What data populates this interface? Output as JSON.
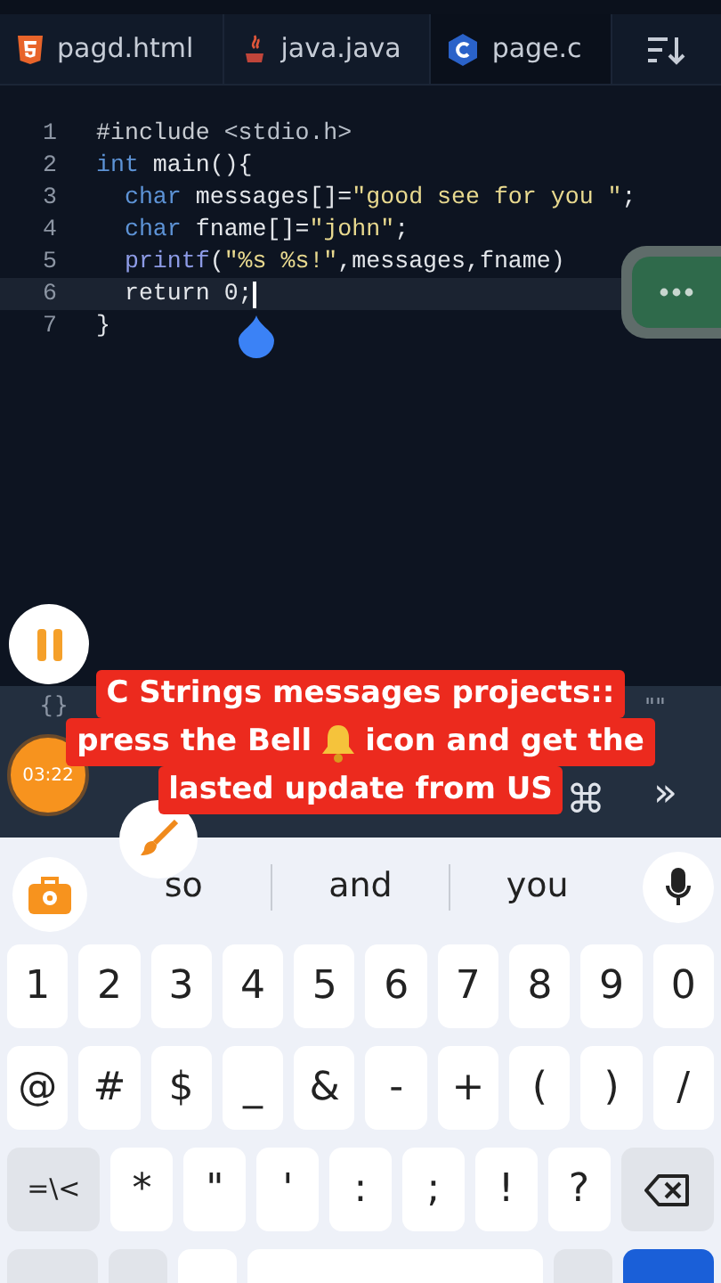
{
  "tabs": [
    {
      "label": "pagd.html",
      "kind": "html",
      "selected": false
    },
    {
      "label": "java.java",
      "kind": "java",
      "selected": false
    },
    {
      "label": "page.c",
      "kind": "c",
      "selected": true
    }
  ],
  "code": {
    "lines": [
      {
        "number": "1",
        "current": false,
        "tokens": [
          {
            "text": "#include ",
            "kind": "directive"
          },
          {
            "text": "<stdio.h>",
            "kind": "header"
          }
        ]
      },
      {
        "number": "2",
        "current": false,
        "tokens": [
          {
            "text": "int",
            "kind": "keyword"
          },
          {
            "text": " main(){",
            "kind": "plain"
          }
        ]
      },
      {
        "number": "3",
        "current": false,
        "tokens": [
          {
            "text": "  char",
            "kind": "keyword"
          },
          {
            "text": " messages[]=",
            "kind": "plain"
          },
          {
            "text": "\"good see for you \"",
            "kind": "string"
          },
          {
            "text": ";",
            "kind": "plain"
          }
        ]
      },
      {
        "number": "4",
        "current": false,
        "tokens": [
          {
            "text": "  char",
            "kind": "keyword"
          },
          {
            "text": " fname[]=",
            "kind": "plain"
          },
          {
            "text": "\"john\"",
            "kind": "string"
          },
          {
            "text": ";",
            "kind": "plain"
          }
        ]
      },
      {
        "number": "5",
        "current": false,
        "tokens": [
          {
            "text": "  printf",
            "kind": "function"
          },
          {
            "text": "(",
            "kind": "plain"
          },
          {
            "text": "\"%s %s!\"",
            "kind": "string"
          },
          {
            "text": ",messages,fname)",
            "kind": "plain"
          }
        ]
      },
      {
        "number": "6",
        "current": true,
        "tokens": [
          {
            "text": "  return 0;",
            "kind": "plain"
          }
        ]
      },
      {
        "number": "7",
        "current": false,
        "tokens": [
          {
            "text": "}",
            "kind": "plain"
          }
        ]
      }
    ]
  },
  "toolbar": {
    "items": [
      "{}",
      "\"\"",
      "⌘",
      "»"
    ]
  },
  "timer": "03:22",
  "caption": {
    "line1": "C Strings messages projects::",
    "line2_before": "press the Bell",
    "line2_after": "icon and get the",
    "line3": "lasted update from US"
  },
  "suggestions": [
    "so",
    "and",
    "you"
  ],
  "keyboard": {
    "rows": [
      [
        "1",
        "2",
        "3",
        "4",
        "5",
        "6",
        "7",
        "8",
        "9",
        "0"
      ],
      [
        "@",
        "#",
        "$",
        "_",
        "&",
        "-",
        "+",
        "(",
        ")",
        "/"
      ],
      [
        "=\\<",
        "*",
        "\"",
        "'",
        ":",
        ";",
        "!",
        "?"
      ]
    ]
  }
}
